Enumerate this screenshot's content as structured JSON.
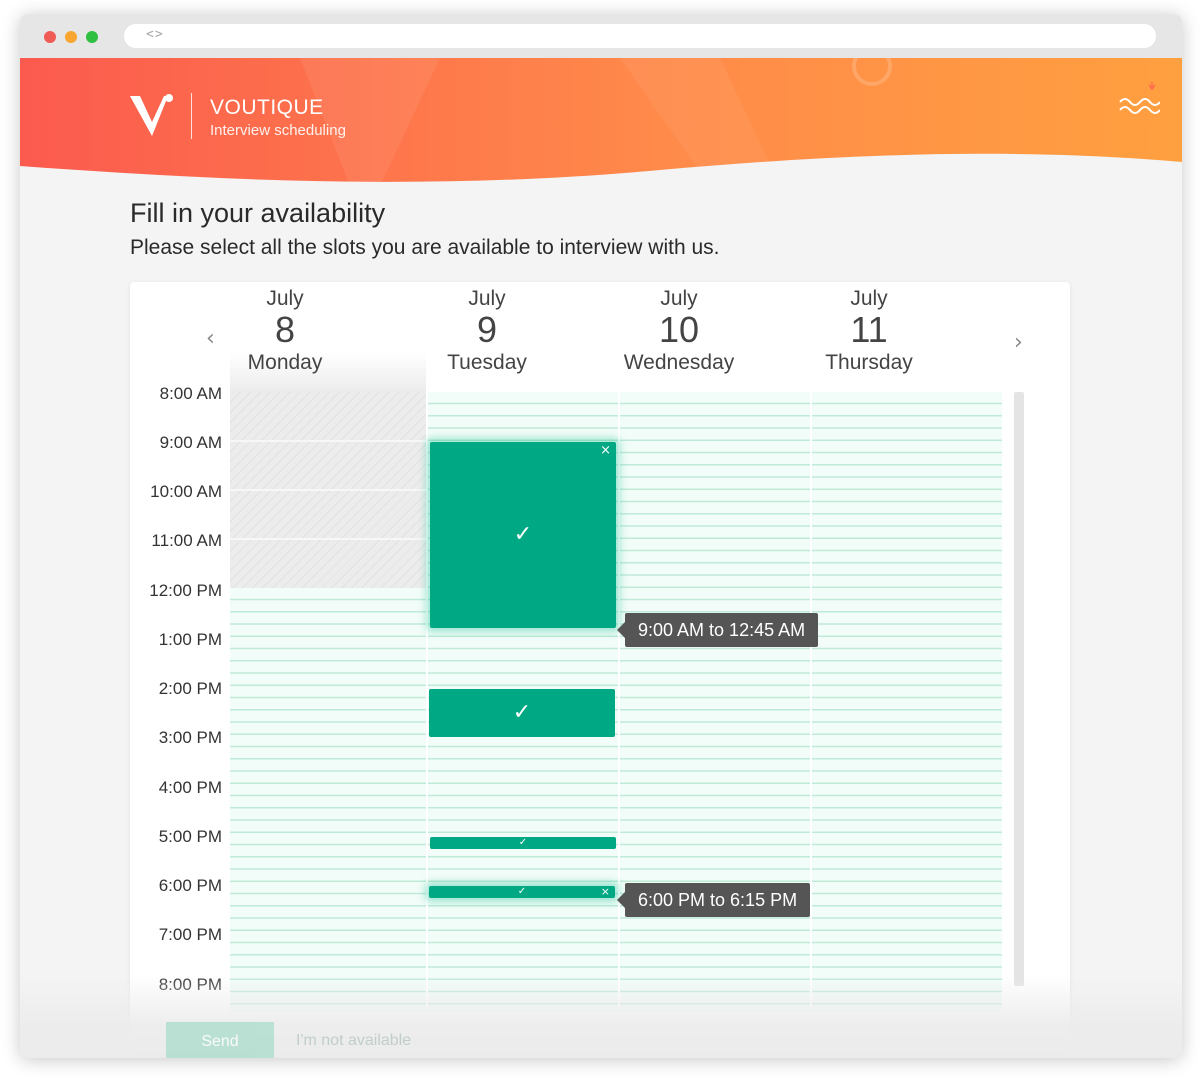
{
  "browser": {
    "code_icon": "code-brackets-icon"
  },
  "header": {
    "brand_name": "VOUTIQUE",
    "brand_subtitle": "Interview scheduling",
    "colors": {
      "gradient_start": "#fb5a4e",
      "gradient_end": "#ffa040"
    }
  },
  "page": {
    "title": "Fill in your availability",
    "subtitle": "Please select all the slots you are available to interview with us."
  },
  "calendar": {
    "prev_icon": "chevron-left-icon",
    "next_icon": "chevron-right-icon",
    "days": [
      {
        "month": "July",
        "date": "8",
        "weekday": "Monday"
      },
      {
        "month": "July",
        "date": "9",
        "weekday": "Tuesday"
      },
      {
        "month": "July",
        "date": "10",
        "weekday": "Wednesday"
      },
      {
        "month": "July",
        "date": "11",
        "weekday": "Thursday"
      }
    ],
    "times": [
      "8:00 AM",
      "9:00 AM",
      "10:00 AM",
      "11:00 AM",
      "12:00 PM",
      "1:00 PM",
      "2:00 PM",
      "3:00 PM",
      "4:00 PM",
      "5:00  PM",
      "6:00  PM",
      "7:00 PM",
      "8:00  PM"
    ],
    "slots": [
      {
        "day": "Tuesday",
        "check": "✓",
        "close": "×"
      },
      {
        "day": "Tuesday",
        "check": "✓"
      },
      {
        "day": "Tuesday",
        "check": "✓"
      },
      {
        "day": "Tuesday",
        "check": "✓",
        "close": "×"
      }
    ],
    "tooltips": [
      "9:00 AM to 12:45 AM",
      "6:00 PM to 6:15 PM"
    ],
    "slot_color": "#00a884"
  },
  "footer": {
    "send_label": "Send",
    "not_available_label": "I'm not available"
  }
}
